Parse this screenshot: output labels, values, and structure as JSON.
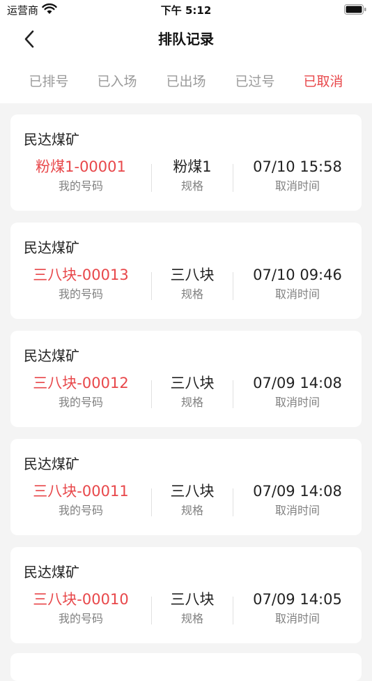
{
  "status_bar": {
    "carrier": "运营商",
    "time": "下午 5:12"
  },
  "header": {
    "title": "排队记录"
  },
  "tabs": [
    {
      "label": "已排号",
      "active": false
    },
    {
      "label": "已入场",
      "active": false
    },
    {
      "label": "已出场",
      "active": false
    },
    {
      "label": "已过号",
      "active": false
    },
    {
      "label": "已取消",
      "active": true
    }
  ],
  "colors": {
    "accent": "#e8474a",
    "muted": "#9a9a9a",
    "background": "#f4f4f4"
  },
  "records": [
    {
      "mine": "民达煤矿",
      "number": "粉煤1-00001",
      "number_label": "我的号码",
      "spec": "粉煤1",
      "spec_label": "规格",
      "time": "07/10 15:58",
      "time_label": "取消时间"
    },
    {
      "mine": "民达煤矿",
      "number": "三八块-00013",
      "number_label": "我的号码",
      "spec": "三八块",
      "spec_label": "规格",
      "time": "07/10 09:46",
      "time_label": "取消时间"
    },
    {
      "mine": "民达煤矿",
      "number": "三八块-00012",
      "number_label": "我的号码",
      "spec": "三八块",
      "spec_label": "规格",
      "time": "07/09 14:08",
      "time_label": "取消时间"
    },
    {
      "mine": "民达煤矿",
      "number": "三八块-00011",
      "number_label": "我的号码",
      "spec": "三八块",
      "spec_label": "规格",
      "time": "07/09 14:08",
      "time_label": "取消时间"
    },
    {
      "mine": "民达煤矿",
      "number": "三八块-00010",
      "number_label": "我的号码",
      "spec": "三八块",
      "spec_label": "规格",
      "time": "07/09 14:05",
      "time_label": "取消时间"
    }
  ]
}
